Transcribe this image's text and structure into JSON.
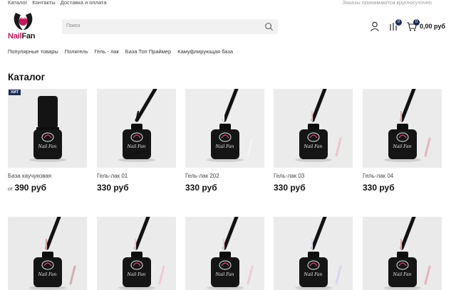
{
  "topbar": {
    "links": [
      "Каталог",
      "Контакты",
      "Доставка и оплата"
    ],
    "notice": "Заказы принимаются круглосуточно"
  },
  "logo": {
    "nail": "Nail",
    "fan": "Fan"
  },
  "search": {
    "placeholder": "Поиск"
  },
  "header": {
    "compare_count": "0",
    "cart_count": "0",
    "cart_total": "0,00 руб"
  },
  "catnav": [
    "Популярные товары",
    "Полигель",
    "Гель - лак",
    "База Топ Праймер",
    "Камуфлирующая база"
  ],
  "page_title": "Каталог",
  "products": [
    {
      "name": "База каучуковая",
      "from": "от",
      "price": "390 руб",
      "badge": "ХИТ",
      "bottle_label": "Nail Fan",
      "bg": "#ebebeb",
      "brush": "none",
      "gel": "#1a1a1a"
    },
    {
      "name": "Гель-лак 01",
      "from": "",
      "price": "330 руб",
      "badge": "",
      "bottle_label": "Nail Fan",
      "bg": "#ececec",
      "brush": "left",
      "gel": "#111111"
    },
    {
      "name": "Гель-лак 202",
      "from": "",
      "price": "330 руб",
      "badge": "",
      "bottle_label": "Nail Fan",
      "bg": "#ededed",
      "brush": "right",
      "gel": "#f5f5f5"
    },
    {
      "name": "Гель-лак 03",
      "from": "",
      "price": "330 руб",
      "badge": "",
      "bottle_label": "Nail Fan",
      "bg": "#ebebeb",
      "brush": "right",
      "gel": "#e7c3c0"
    },
    {
      "name": "Гель-лак 04",
      "from": "",
      "price": "330 руб",
      "badge": "",
      "bottle_label": "Nail Fan",
      "bg": "#ebebeb",
      "brush": "right",
      "gel": "#e3aeb2"
    },
    {
      "name": "",
      "from": "",
      "price": "",
      "badge": "",
      "bottle_label": "Nail Fan",
      "bg": "#eaeaea",
      "brush": "right",
      "gel": "#d8a3a4"
    },
    {
      "name": "",
      "from": "",
      "price": "",
      "badge": "",
      "bottle_label": "Nail Fan",
      "bg": "#ebebeb",
      "brush": "right",
      "gel": "#f2c3cc"
    },
    {
      "name": "",
      "from": "",
      "price": "",
      "badge": "",
      "bottle_label": "Nail Fan",
      "bg": "#ececec",
      "brush": "right",
      "gel": "#eec6d9"
    },
    {
      "name": "",
      "from": "",
      "price": "",
      "badge": "",
      "bottle_label": "Nail Fan",
      "bg": "#ebebeb",
      "brush": "right",
      "gel": "#d8d2ec"
    },
    {
      "name": "",
      "from": "",
      "price": "",
      "badge": "",
      "bottle_label": "Nail Fan",
      "bg": "#eaeaea",
      "brush": "right",
      "gel": "#e8a9b0"
    }
  ],
  "colors": {
    "accent": "#1e2d55",
    "brand": "#c2185b"
  }
}
